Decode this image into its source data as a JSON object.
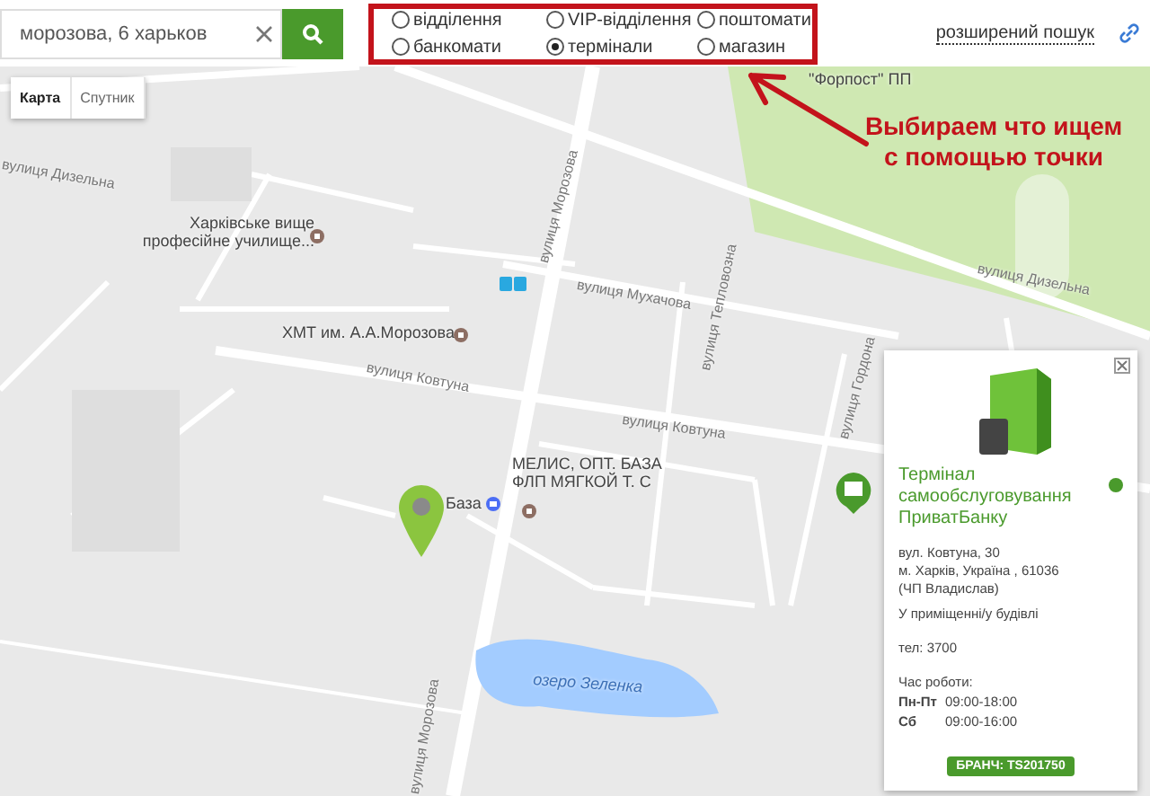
{
  "search": {
    "value": "морозова, 6 харьков"
  },
  "filters": [
    {
      "label": "відділення",
      "selected": false
    },
    {
      "label": "VIP-відділення",
      "selected": false
    },
    {
      "label": "поштомати",
      "selected": false
    },
    {
      "label": "банкомати",
      "selected": false
    },
    {
      "label": "термінали",
      "selected": true
    },
    {
      "label": "магазин",
      "selected": false
    }
  ],
  "advanced_search": "розширений пошук",
  "map": {
    "types": [
      {
        "label": "Карта",
        "selected": true
      },
      {
        "label": "Спутник",
        "selected": false
      }
    ],
    "labels": [
      {
        "text": "\"Форпост\" ПП",
        "kind": "place"
      },
      {
        "text": "вулиця Дизельна",
        "kind": "street"
      },
      {
        "text": "вулиця Морозова",
        "kind": "street"
      },
      {
        "text": "Харківське вище професійне училище...",
        "kind": "place"
      },
      {
        "text": "вулиця Мухачова",
        "kind": "street"
      },
      {
        "text": "вулиця Дизельна",
        "kind": "street"
      },
      {
        "text": "вулиця Тепловозна",
        "kind": "street"
      },
      {
        "text": "ХМТ им. А.А.Морозова",
        "kind": "place"
      },
      {
        "text": "вулиця Ковтуна",
        "kind": "street"
      },
      {
        "text": "вулиця Гордона",
        "kind": "street"
      },
      {
        "text": "вулиця Ковтуна",
        "kind": "street"
      },
      {
        "text": "База",
        "kind": "shop"
      },
      {
        "text": "МЕЛИС, ОПТ. БАЗА ФЛП МЯГКОЙ Т. С",
        "kind": "place"
      },
      {
        "text": "вулиця Морозова",
        "kind": "street"
      },
      {
        "text": "озеро Зеленка",
        "kind": "water"
      }
    ],
    "annotation": "Выбираем что ищем с помощью точки"
  },
  "info": {
    "title": "Термінал самообслуговування ПриватБанку",
    "address": [
      "вул. Ковтуна, 30",
      "м. Харків, Україна , 61036",
      "(ЧП Владислав)"
    ],
    "location": "У приміщенні/у будівлі",
    "phone": "тел: 3700",
    "hours_title": "Час роботи:",
    "hours": [
      {
        "days": "Пн-Пт",
        "time": "09:00-18:00"
      },
      {
        "days": "Сб",
        "time": "09:00-16:00"
      }
    ],
    "branch": "БРАНЧ: TS201750"
  }
}
